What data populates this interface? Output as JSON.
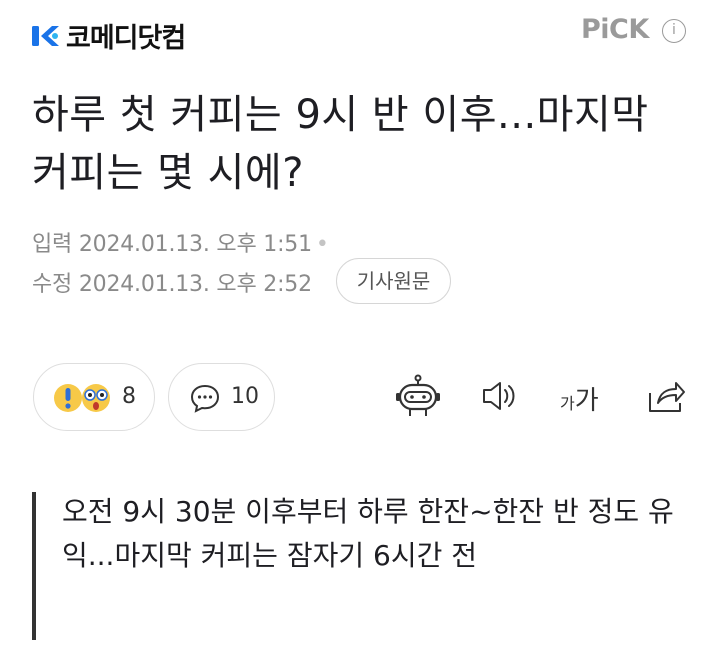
{
  "header": {
    "logo_text": "코메디닷컴",
    "pick_label": "PiCK",
    "info_icon": "info-icon"
  },
  "article": {
    "title": "하루 첫 커피는 9시 반 이후...마지막 커피는 몇 시에?",
    "published": "입력 2024.01.13. 오후 1:51",
    "modified": "수정 2024.01.13. 오후 2:52",
    "original_button": "기사원문",
    "summary": "오전 9시 30분 이후부터 하루 한잔~한잔 반 정도 유익...마지막 커피는 잠자기 6시간 전"
  },
  "actions": {
    "reaction_count": "8",
    "comment_count": "10",
    "font_size_small": "가",
    "font_size_large": "가",
    "icons": [
      "wow-emoji-icon",
      "comment-icon",
      "robot-summary-icon",
      "speaker-icon",
      "font-size-icon",
      "share-icon"
    ]
  },
  "colors": {
    "brand_blue": "#1a73e8",
    "text_primary": "#1e1e23",
    "text_secondary": "#8a8a8a",
    "pick_gray": "#9a9a9a",
    "emoji_yellow": "#f7c948"
  }
}
